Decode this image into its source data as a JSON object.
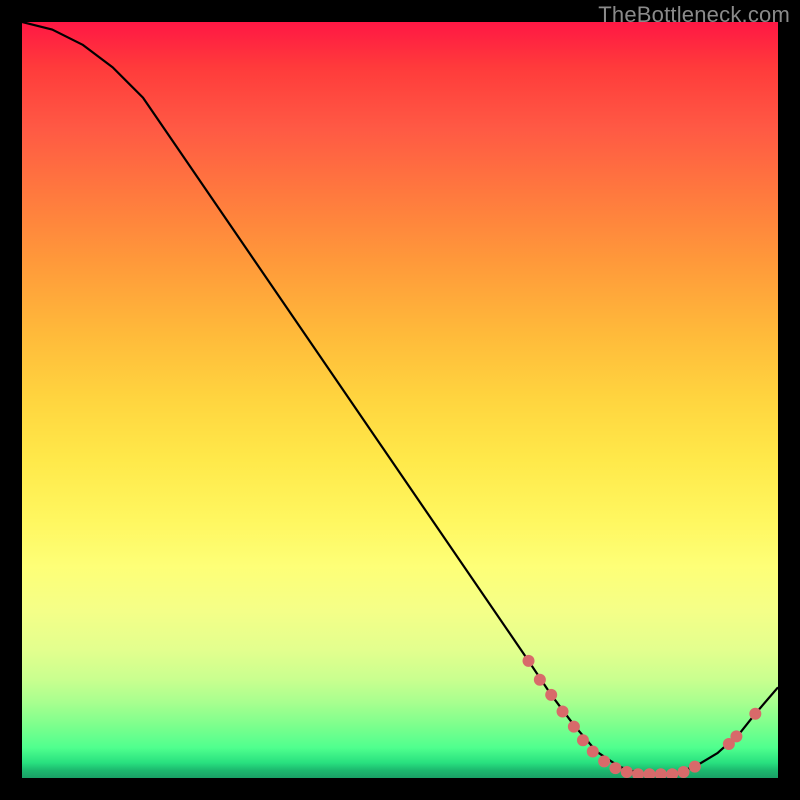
{
  "watermark": "TheBottleneck.com",
  "chart_data": {
    "type": "line",
    "x_range": [
      0,
      100
    ],
    "y_range": [
      0,
      100
    ],
    "title": "",
    "xlabel": "",
    "ylabel": "",
    "series": [
      {
        "name": "curve",
        "points": [
          {
            "x": 0,
            "y": 100
          },
          {
            "x": 4,
            "y": 99
          },
          {
            "x": 8,
            "y": 97
          },
          {
            "x": 12,
            "y": 94
          },
          {
            "x": 16,
            "y": 90
          },
          {
            "x": 67,
            "y": 15.5
          },
          {
            "x": 70,
            "y": 11
          },
          {
            "x": 73,
            "y": 7
          },
          {
            "x": 76,
            "y": 3.5
          },
          {
            "x": 79,
            "y": 1.5
          },
          {
            "x": 82,
            "y": 0.5
          },
          {
            "x": 86,
            "y": 0.5
          },
          {
            "x": 89,
            "y": 1.5
          },
          {
            "x": 92,
            "y": 3.3
          },
          {
            "x": 95,
            "y": 6.0
          },
          {
            "x": 97,
            "y": 8.5
          },
          {
            "x": 100,
            "y": 12
          }
        ]
      },
      {
        "name": "markers",
        "points": [
          {
            "x": 67.0,
            "y": 15.5
          },
          {
            "x": 68.5,
            "y": 13.0
          },
          {
            "x": 70.0,
            "y": 11.0
          },
          {
            "x": 71.5,
            "y": 8.8
          },
          {
            "x": 73.0,
            "y": 6.8
          },
          {
            "x": 74.2,
            "y": 5.0
          },
          {
            "x": 75.5,
            "y": 3.5
          },
          {
            "x": 77.0,
            "y": 2.2
          },
          {
            "x": 78.5,
            "y": 1.3
          },
          {
            "x": 80.0,
            "y": 0.8
          },
          {
            "x": 81.5,
            "y": 0.5
          },
          {
            "x": 83.0,
            "y": 0.5
          },
          {
            "x": 84.5,
            "y": 0.5
          },
          {
            "x": 86.0,
            "y": 0.5
          },
          {
            "x": 87.5,
            "y": 0.8
          },
          {
            "x": 89.0,
            "y": 1.5
          },
          {
            "x": 93.5,
            "y": 4.5
          },
          {
            "x": 94.5,
            "y": 5.5
          },
          {
            "x": 97.0,
            "y": 8.5
          }
        ]
      }
    ]
  }
}
